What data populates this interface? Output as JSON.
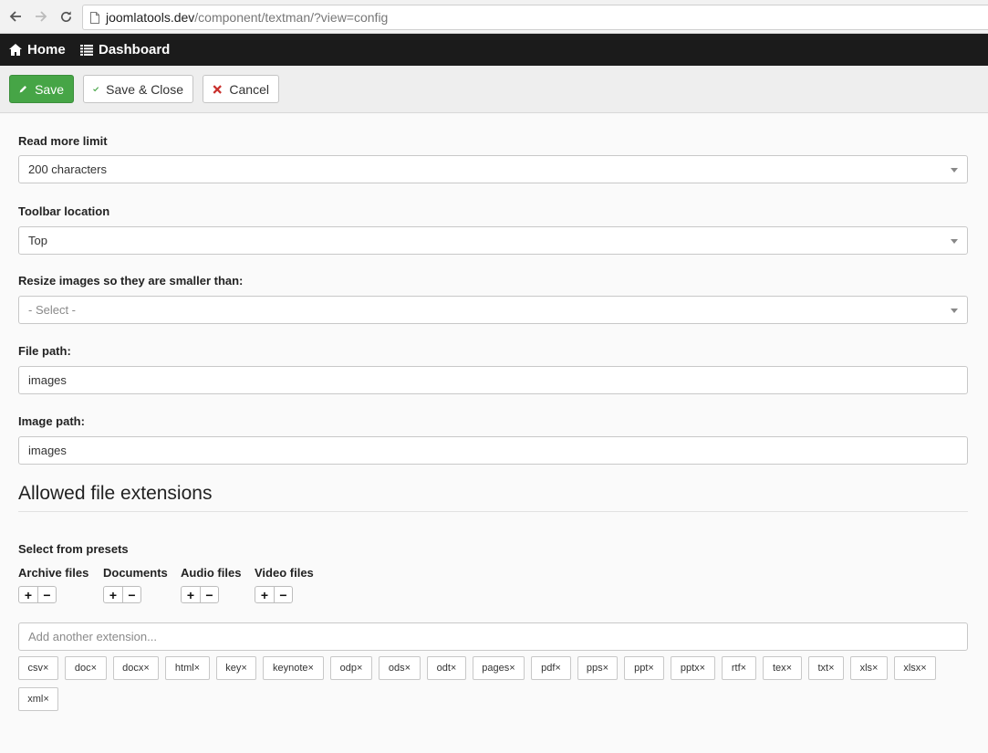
{
  "browser": {
    "url_host": "joomlatools.dev",
    "url_path": "/component/textman/?view=config"
  },
  "admin_nav": {
    "home": "Home",
    "dashboard": "Dashboard"
  },
  "toolbar": {
    "save": "Save",
    "save_close": "Save & Close",
    "cancel": "Cancel"
  },
  "form": {
    "read_more": {
      "label": "Read more limit",
      "value": "200 characters"
    },
    "toolbar_location": {
      "label": "Toolbar location",
      "value": "Top"
    },
    "resize_images": {
      "label": "Resize images so they are smaller than:",
      "placeholder": "- Select -"
    },
    "file_path": {
      "label": "File path:",
      "value": "images"
    },
    "image_path": {
      "label": "Image path:",
      "value": "images"
    }
  },
  "extensions": {
    "title": "Allowed file extensions",
    "presets_label": "Select from presets",
    "presets": [
      "Archive files",
      "Documents",
      "Audio files",
      "Video files"
    ],
    "add_placeholder": "Add another extension...",
    "chips": [
      "csv×",
      "doc×",
      "docx×",
      "html×",
      "key×",
      "keynote×",
      "odp×",
      "ods×",
      "odt×",
      "pages×",
      "pdf×",
      "pps×",
      "ppt×",
      "pptx×",
      "rtf×",
      "tex×",
      "txt×",
      "xls×",
      "xlsx×",
      "xml×"
    ]
  },
  "colors": {
    "save_green": "#46a546",
    "admin_bar": "#1b1b1b",
    "cancel_red": "#c9302c",
    "check_green": "#46a546"
  }
}
